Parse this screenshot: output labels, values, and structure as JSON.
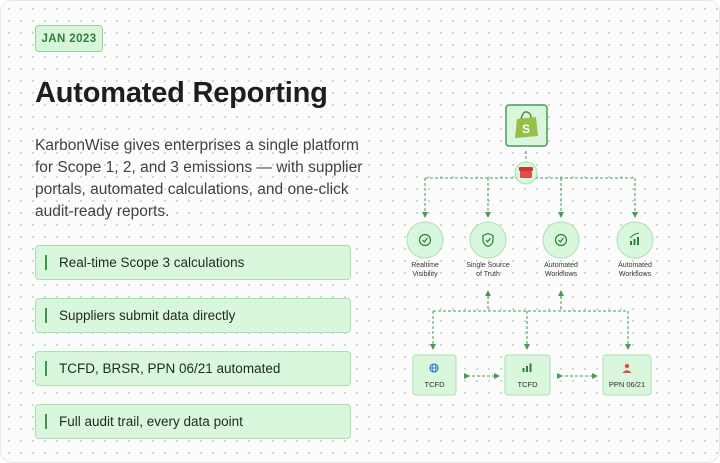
{
  "header": {
    "badge": "JAN 2023",
    "title": "Automated Reporting"
  },
  "description": "KarbonWise gives enterprises a single platform for Scope 1, 2, and 3 emissions — with supplier portals, automated calculations, and one-click audit-ready reports.",
  "features": [
    {
      "label": "Real-time Scope 3 calculations"
    },
    {
      "label": "Suppliers submit data directly"
    },
    {
      "label": "TCFD, BRSR, PPN 06/21 automated"
    },
    {
      "label": "Full audit trail, every data point"
    }
  ],
  "diagram": {
    "top_icon": "shopping-bag-icon",
    "hub_icon": "store-icon",
    "nodes": [
      {
        "label_1": "Realtime",
        "label_2": "Visibility",
        "icon": "check-circle-icon"
      },
      {
        "label_1": "Single Source",
        "label_2": "of Truth",
        "icon": "shield-check-icon"
      },
      {
        "label_1": "Automated",
        "label_2": "Workflows",
        "icon": "check-circle-icon"
      },
      {
        "label_1": "Automated",
        "label_2": "Workflows",
        "icon": "growth-chart-icon"
      }
    ],
    "bottom_boxes": [
      {
        "label": "TCFD",
        "icon": "globe-icon"
      },
      {
        "label": "TCFD",
        "icon": "bar-chart-icon"
      },
      {
        "label": "PPN 06/21",
        "icon": "person-icon"
      }
    ]
  },
  "colors": {
    "accent": "#3a9a4a",
    "badge_bg": "#d7f5d9",
    "feature_bg": "#d9f7dc",
    "hub_red": "#e24b4b"
  }
}
